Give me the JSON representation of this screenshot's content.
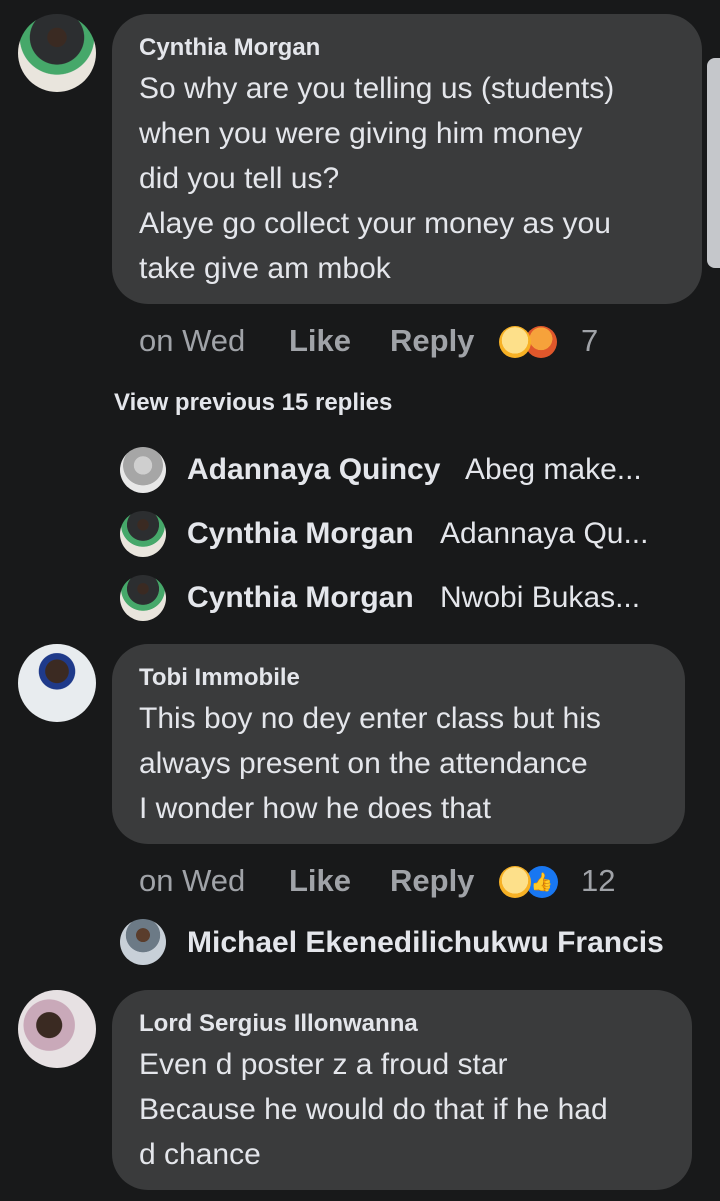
{
  "comments": [
    {
      "author": "Cynthia Morgan",
      "lines": [
        "So why are you telling us (students)",
        "when you were giving him money",
        "did you tell us?",
        "Alaye go collect your money as you",
        "take give am mbok"
      ],
      "time": "on Wed",
      "like": "Like",
      "reply": "Reply",
      "reactions": [
        "haha",
        "angry"
      ],
      "reaction_count": "7"
    },
    {
      "author": "Tobi Immobile",
      "lines": [
        "This boy no dey enter class but his",
        "always present on the attendance",
        "I wonder how he does that"
      ],
      "time": "on Wed",
      "like": "Like",
      "reply": "Reply",
      "reactions": [
        "haha",
        "like"
      ],
      "reaction_count": "12"
    },
    {
      "author": "Lord Sergius Illonwanna",
      "lines": [
        "Even d poster z a froud star",
        "Because he would do that if he had",
        "d chance"
      ]
    }
  ],
  "view_previous": "View previous 15 replies",
  "replies": [
    {
      "name": "Adannaya Quincy",
      "snippet": "Abeg make..."
    },
    {
      "name": "Cynthia Morgan",
      "snippet": "Adannaya Qu..."
    },
    {
      "name": "Cynthia Morgan",
      "snippet": "Nwobi Bukas..."
    }
  ],
  "tobi_reply": {
    "name": "Michael Ekenedilichukwu Francis"
  }
}
